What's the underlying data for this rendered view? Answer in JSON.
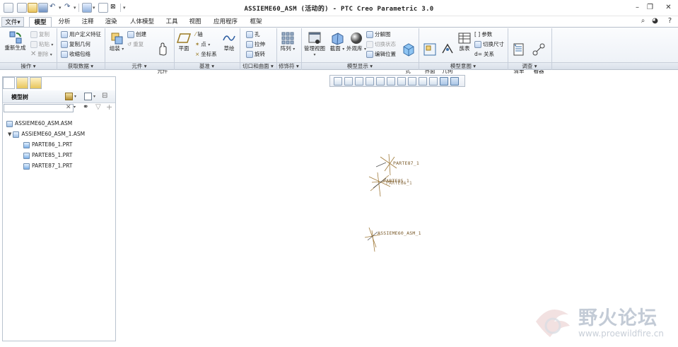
{
  "window": {
    "title": "ASSIEME60_ASM (活动的) - PTC Creo Parametric 3.0"
  },
  "menu": {
    "tabs": [
      "文件▾",
      "模型",
      "分析",
      "注释",
      "渲染",
      "人体模型",
      "工具",
      "视图",
      "应用程序",
      "框架"
    ],
    "active_tab": "模型"
  },
  "ribbon": {
    "groups": {
      "operations": "操作 ▾",
      "get_data": "获取数据 ▾",
      "components": "元件 ▾",
      "datum": "基准 ▾",
      "cut_surface": "切口和曲面 ▾",
      "modifiers": "修饰符 ▾",
      "model_display": "模型显示 ▾",
      "model_intent": "模型意图 ▾",
      "investigate": "调查 ▾"
    },
    "regenerate": "重新生成",
    "copy": "复制",
    "paste": "粘贴",
    "delete": "删除",
    "user_defined_feature": "用户定义特征",
    "copy_geometry": "复制几何",
    "shrinkwrap": "收缩包络",
    "assemble": "组装",
    "create": "创建",
    "repeat": "重复",
    "drag_components": "拖动\n元件",
    "plane": "平面",
    "axis": "轴",
    "point": "点",
    "csys": "坐标系",
    "sketch": "草绘",
    "hole": "孔",
    "extrude": "拉伸",
    "revolve": "旋转",
    "pattern": "阵列",
    "manage_views": "管理视图",
    "section": "截面",
    "appearance_gallery": "外观库",
    "exploded_view": "分解图",
    "toggle_status": "切换状态",
    "edit_position": "编辑位置",
    "display_style": "显示样\n式",
    "component_interface": "元件\n界面",
    "publish_geometry": "发布\n几何",
    "family_table": "族表",
    "parameters": "参数",
    "switch_dimensions": "切换尺寸",
    "relations": "关系",
    "bill_of_materials": "材料\n清单",
    "reference_viewer": "参考查\n看器"
  },
  "sidebar": {
    "panel_title": "模型树",
    "search_placeholder": "",
    "tree": [
      {
        "label": "ASSIEME60_ASM.ASM",
        "level": 0
      },
      {
        "label": "ASSIEME60_ASM_1.ASM",
        "level": 1
      },
      {
        "label": "PARTE86_1.PRT",
        "level": 2
      },
      {
        "label": "PARTE85_1.PRT",
        "level": 2
      },
      {
        "label": "PARTE87_1.PRT",
        "level": 2
      }
    ]
  },
  "canvas": {
    "csys_labels": [
      "PARTE87_1",
      "PARTE85_1",
      "PARTE86_1",
      "ASSIEME60_ASM_1"
    ]
  },
  "watermark": {
    "name": "野火论坛",
    "url": "www.proewildfire.cn"
  },
  "colors": {
    "ribbon_bg": "#eef2f7",
    "csys_label": "#7a5a2a",
    "csys_line": "#a07a3a"
  }
}
